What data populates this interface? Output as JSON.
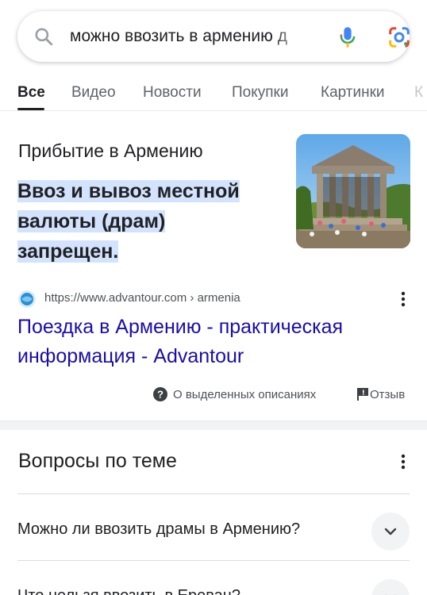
{
  "search": {
    "query": "можно ввозить в армению д",
    "search_icon": "search-icon",
    "mic_icon": "microphone-icon",
    "lens_icon": "google-lens-icon"
  },
  "tabs": [
    {
      "label": "Все",
      "active": true
    },
    {
      "label": "Видео",
      "active": false
    },
    {
      "label": "Новости",
      "active": false
    },
    {
      "label": "Покупки",
      "active": false
    },
    {
      "label": "Картинки",
      "active": false
    },
    {
      "label": "К",
      "active": false
    }
  ],
  "featured_snippet": {
    "heading": "Прибытие в Армению",
    "answer": "Ввоз и вывоз местной валюты (драм) запрещен.",
    "image_description_icon": "garni-temple-thumbnail",
    "source_url": "https://www.advantour.com › armenia",
    "result_title": "Поездка в Армению - практическая информация - Advantour",
    "about_label": "О выделенных описаниях",
    "feedback_label": "Отзыв"
  },
  "people_also_ask": {
    "title": "Вопросы по теме",
    "questions": [
      "Можно ли ввозить драмы в Армению?",
      "Что нельзя ввозить в Ереван?"
    ]
  },
  "colors": {
    "link": "#1a0dab",
    "highlight": "#d3e3fd",
    "text": "#202124",
    "muted": "#5f6368"
  }
}
